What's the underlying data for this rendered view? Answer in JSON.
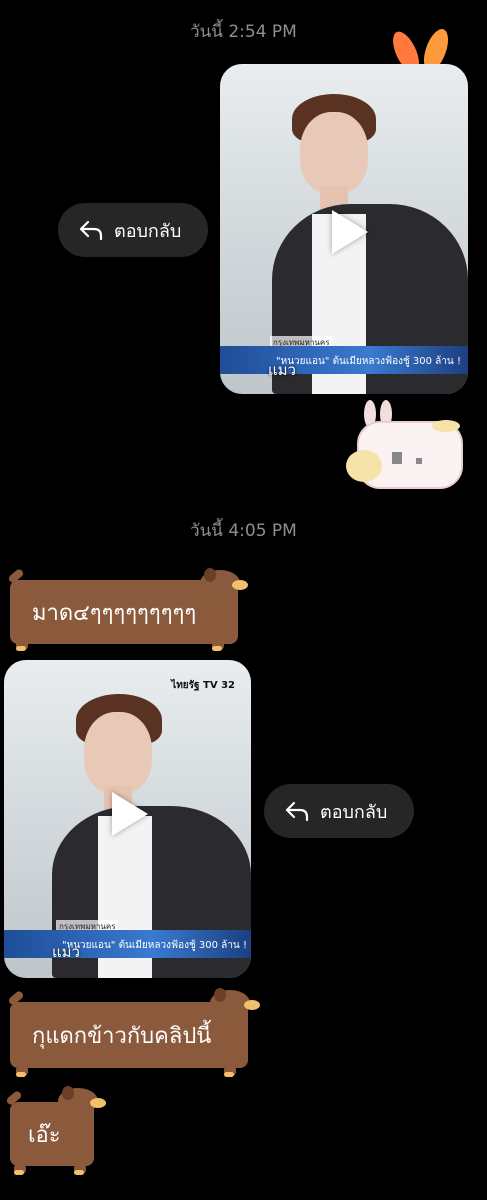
{
  "timestamps": [
    "วันนี้ 2:54 PM",
    "วันนี้ 4:05 PM"
  ],
  "reply_label": "ตอบกลับ",
  "video": {
    "caption": "แมว",
    "banner_text": "\"หนวยแอน\" ต้นเมียหลวงฟ้องชู้ 300 ล้าน !",
    "banner_tag": "กรุงเทพมหานคร",
    "channel_logo": "ไทยรัฐ TV 32",
    "top_logo_short": "32"
  },
  "messages": [
    {
      "text": "มาด๔ๆๆๆๆๆๆๆๆๆ"
    },
    {
      "text": "กุแดกข้าวกับคลิปนี้"
    },
    {
      "text": "เอ๊ะ"
    }
  ],
  "colors": {
    "background": "#000000",
    "bubble": "#8b5a3c",
    "reply_pill": "#262626",
    "timestamp": "#8e8e8e"
  },
  "icons": [
    "reply-arrow-icon",
    "play-icon"
  ]
}
